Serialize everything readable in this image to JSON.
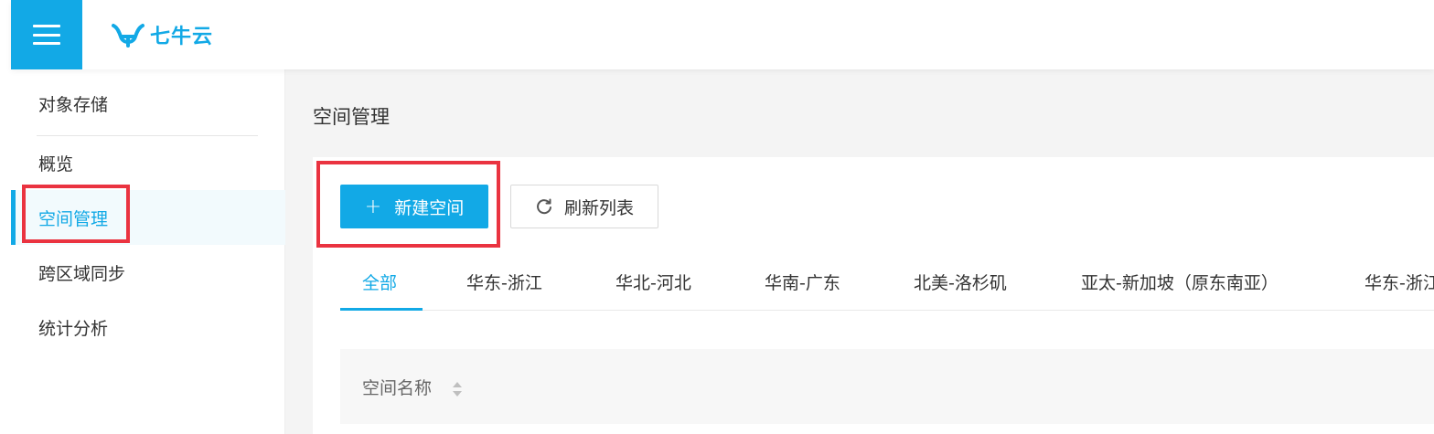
{
  "header": {
    "brand_name": "七牛云",
    "brand_color": "#12a9e6",
    "menu_icon": "hamburger-menu-icon"
  },
  "sidebar": {
    "title": "对象存储",
    "items": [
      {
        "label": "概览",
        "active": false
      },
      {
        "label": "空间管理",
        "active": true
      },
      {
        "label": "跨区域同步",
        "active": false
      },
      {
        "label": "统计分析",
        "active": false
      }
    ]
  },
  "main": {
    "page_title": "空间管理",
    "toolbar": {
      "create_label": "新建空间",
      "create_icon": "plus-icon",
      "refresh_label": "刷新列表",
      "refresh_icon": "refresh-icon"
    },
    "tabs": [
      {
        "label": "全部",
        "active": true
      },
      {
        "label": "华东-浙江"
      },
      {
        "label": "华北-河北"
      },
      {
        "label": "华南-广东"
      },
      {
        "label": "北美-洛杉矶"
      },
      {
        "label": "亚太-新加坡（原东南亚）"
      },
      {
        "label": "华东-浙江"
      }
    ],
    "table": {
      "columns": [
        {
          "label": "空间名称",
          "sortable": true
        }
      ]
    }
  },
  "colors": {
    "accent": "#12a9e6",
    "highlight": "#ea3340"
  }
}
